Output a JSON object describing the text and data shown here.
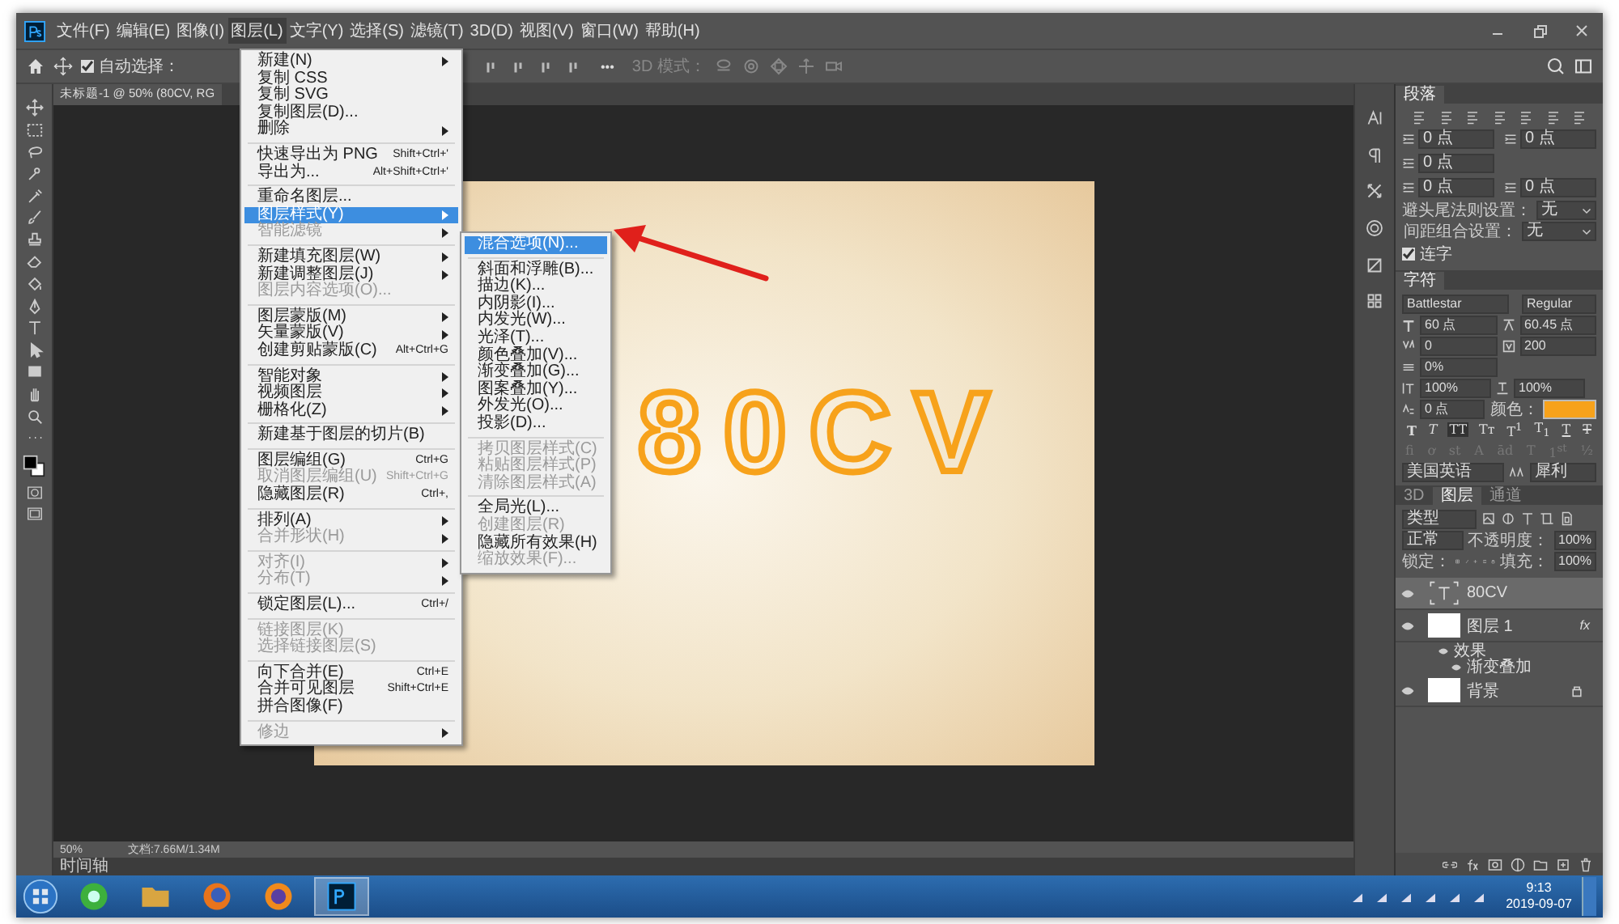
{
  "menubar": [
    {
      "label": "文件(F)",
      "selected": false
    },
    {
      "label": "编辑(E)",
      "selected": false
    },
    {
      "label": "图像(I)",
      "selected": false
    },
    {
      "label": "图层(L)",
      "selected": true
    },
    {
      "label": "文字(Y)",
      "selected": false
    },
    {
      "label": "选择(S)",
      "selected": false
    },
    {
      "label": "滤镜(T)",
      "selected": false
    },
    {
      "label": "3D(D)",
      "selected": false
    },
    {
      "label": "视图(V)",
      "selected": false
    },
    {
      "label": "窗口(W)",
      "selected": false
    },
    {
      "label": "帮助(H)",
      "selected": false
    }
  ],
  "options_bar": {
    "auto_select": {
      "label": "自动选择：",
      "checked": true
    },
    "more": "•••",
    "mode_3d": "3D 模式："
  },
  "document": {
    "tab": "未标题-1 @ 50% (80CV, RG",
    "canvas_text": "80CV"
  },
  "menu": {
    "groups": [
      [
        {
          "label": "新建(N)",
          "submenu": true,
          "disabled": false,
          "selected": false
        },
        {
          "label": "复制 CSS",
          "submenu": false,
          "disabled": false,
          "selected": false
        },
        {
          "label": "复制 SVG",
          "submenu": false,
          "disabled": false,
          "selected": false
        },
        {
          "label": "复制图层(D)...",
          "submenu": false,
          "disabled": false,
          "selected": false
        },
        {
          "label": "删除",
          "submenu": true,
          "disabled": false,
          "selected": false
        }
      ],
      [
        {
          "label": "快速导出为 PNG",
          "shortcut": "Shift+Ctrl+'",
          "submenu": false,
          "disabled": false,
          "selected": false
        },
        {
          "label": "导出为...",
          "shortcut": "Alt+Shift+Ctrl+'",
          "submenu": false,
          "disabled": false,
          "selected": false
        }
      ],
      [
        {
          "label": "重命名图层...",
          "submenu": false,
          "disabled": false,
          "selected": false
        },
        {
          "label": "图层样式(Y)",
          "submenu": true,
          "disabled": false,
          "selected": true
        },
        {
          "label": "智能滤镜",
          "submenu": true,
          "disabled": true,
          "selected": false
        }
      ],
      [
        {
          "label": "新建填充图层(W)",
          "submenu": true,
          "disabled": false,
          "selected": false
        },
        {
          "label": "新建调整图层(J)",
          "submenu": true,
          "disabled": false,
          "selected": false
        },
        {
          "label": "图层内容选项(O)...",
          "submenu": false,
          "disabled": true,
          "selected": false
        }
      ],
      [
        {
          "label": "图层蒙版(M)",
          "submenu": true,
          "disabled": false,
          "selected": false
        },
        {
          "label": "矢量蒙版(V)",
          "submenu": true,
          "disabled": false,
          "selected": false
        },
        {
          "label": "创建剪贴蒙版(C)",
          "shortcut": "Alt+Ctrl+G",
          "submenu": false,
          "disabled": false,
          "selected": false
        }
      ],
      [
        {
          "label": "智能对象",
          "submenu": true,
          "disabled": false,
          "selected": false
        },
        {
          "label": "视频图层",
          "submenu": true,
          "disabled": false,
          "selected": false
        },
        {
          "label": "栅格化(Z)",
          "submenu": true,
          "disabled": false,
          "selected": false
        }
      ],
      [
        {
          "label": "新建基于图层的切片(B)",
          "submenu": false,
          "disabled": false,
          "selected": false
        }
      ],
      [
        {
          "label": "图层编组(G)",
          "shortcut": "Ctrl+G",
          "submenu": false,
          "disabled": false,
          "selected": false
        },
        {
          "label": "取消图层编组(U)",
          "shortcut": "Shift+Ctrl+G",
          "submenu": false,
          "disabled": true,
          "selected": false
        },
        {
          "label": "隐藏图层(R)",
          "shortcut": "Ctrl+,",
          "submenu": false,
          "disabled": false,
          "selected": false
        }
      ],
      [
        {
          "label": "排列(A)",
          "submenu": true,
          "disabled": false,
          "selected": false
        },
        {
          "label": "合并形状(H)",
          "submenu": true,
          "disabled": true,
          "selected": false
        }
      ],
      [
        {
          "label": "对齐(I)",
          "submenu": true,
          "disabled": true,
          "selected": false
        },
        {
          "label": "分布(T)",
          "submenu": true,
          "disabled": true,
          "selected": false
        }
      ],
      [
        {
          "label": "锁定图层(L)...",
          "shortcut": "Ctrl+/",
          "submenu": false,
          "disabled": false,
          "selected": false
        }
      ],
      [
        {
          "label": "链接图层(K)",
          "submenu": false,
          "disabled": true,
          "selected": false
        },
        {
          "label": "选择链接图层(S)",
          "submenu": false,
          "disabled": true,
          "selected": false
        }
      ],
      [
        {
          "label": "向下合并(E)",
          "shortcut": "Ctrl+E",
          "submenu": false,
          "disabled": false,
          "selected": false
        },
        {
          "label": "合并可见图层",
          "shortcut": "Shift+Ctrl+E",
          "submenu": false,
          "disabled": false,
          "selected": false
        },
        {
          "label": "拼合图像(F)",
          "submenu": false,
          "disabled": false,
          "selected": false
        }
      ],
      [
        {
          "label": "修边",
          "submenu": true,
          "disabled": true,
          "selected": false
        }
      ]
    ]
  },
  "submenu": {
    "groups": [
      [
        {
          "label": "混合选项(N)...",
          "disabled": false,
          "selected": true
        }
      ],
      [
        {
          "label": "斜面和浮雕(B)...",
          "disabled": false,
          "selected": false
        },
        {
          "label": "描边(K)...",
          "disabled": false,
          "selected": false
        },
        {
          "label": "内阴影(I)...",
          "disabled": false,
          "selected": false
        },
        {
          "label": "内发光(W)...",
          "disabled": false,
          "selected": false
        },
        {
          "label": "光泽(T)...",
          "disabled": false,
          "selected": false
        },
        {
          "label": "颜色叠加(V)...",
          "disabled": false,
          "selected": false
        },
        {
          "label": "渐变叠加(G)...",
          "disabled": false,
          "selected": false
        },
        {
          "label": "图案叠加(Y)...",
          "disabled": false,
          "selected": false
        },
        {
          "label": "外发光(O)...",
          "disabled": false,
          "selected": false
        },
        {
          "label": "投影(D)...",
          "disabled": false,
          "selected": false
        }
      ],
      [
        {
          "label": "拷贝图层样式(C)",
          "disabled": true,
          "selected": false
        },
        {
          "label": "粘贴图层样式(P)",
          "disabled": true,
          "selected": false
        },
        {
          "label": "清除图层样式(A)",
          "disabled": true,
          "selected": false
        }
      ],
      [
        {
          "label": "全局光(L)...",
          "disabled": false,
          "selected": false
        },
        {
          "label": "创建图层(R)",
          "disabled": true,
          "selected": false
        },
        {
          "label": "隐藏所有效果(H)",
          "disabled": false,
          "selected": false
        },
        {
          "label": "缩放效果(F)...",
          "disabled": true,
          "selected": false
        }
      ]
    ]
  },
  "paragraph_panel": {
    "title": "段落",
    "indents": [
      "0 点",
      "0 点",
      "0 点",
      "0 点",
      "0 点"
    ],
    "settings": [
      {
        "label": "避头尾法则设置：",
        "value": "无"
      },
      {
        "label": "间距组合设置：",
        "value": "无"
      }
    ],
    "hyphenate": {
      "label": "连字",
      "checked": true
    }
  },
  "character_panel": {
    "title": "字符",
    "font": "Battlestar",
    "style": "Regular",
    "size": "60 点",
    "leading": "60.45 点",
    "kerning": "0",
    "tracking": "200",
    "tsume": "0%",
    "vertical_scale": "100%",
    "horizontal_scale": "100%",
    "baseline": "0 点",
    "color_label": "颜色：",
    "color": "#f7a21b",
    "type_styles": [
      {
        "label": "T",
        "kind": "bold",
        "selected": false
      },
      {
        "label": "T",
        "kind": "italic",
        "selected": false
      },
      {
        "label": "TT",
        "kind": "caps",
        "selected": true
      },
      {
        "label": "Tᴛ",
        "kind": "smallcaps",
        "selected": false
      },
      {
        "label": "T$^{1}$",
        "kind": "super",
        "selected": false
      },
      {
        "label": "T$_{1}$",
        "kind": "sub",
        "selected": false
      },
      {
        "label": "T",
        "kind": "underline",
        "selected": false
      },
      {
        "label": "T",
        "kind": "strike",
        "selected": false
      }
    ],
    "opentype": [
      "fi",
      "ơ",
      "st",
      "A",
      "ād",
      "T",
      "1$^{st}$",
      "½"
    ],
    "language": "美国英语",
    "antialias": "犀利"
  },
  "layers_panel": {
    "tabs": [
      {
        "label": "3D",
        "selected": false
      },
      {
        "label": "图层",
        "selected": true
      },
      {
        "label": "通道",
        "selected": false
      }
    ],
    "filter": "类型",
    "blend": "正常",
    "opacity_label": "不透明度：",
    "opacity": "100%",
    "lock_label": "锁定：",
    "fill_label": "填充：",
    "fill": "100%",
    "layers": [
      {
        "name": "80CV",
        "kind": "text",
        "selected": true,
        "visible": true,
        "locked": false
      },
      {
        "name": "图层 1",
        "kind": "pixel",
        "selected": false,
        "visible": true,
        "locked": false,
        "badge": "fx",
        "children": [
          {
            "name": "效果",
            "visible": true,
            "children": [
              {
                "name": "渐变叠加",
                "visible": true
              }
            ]
          }
        ]
      },
      {
        "name": "背景",
        "kind": "pixel",
        "selected": false,
        "visible": true,
        "locked": true
      }
    ]
  },
  "status_bar": {
    "zoom": "50%",
    "doc_size": "文档:7.66M/1.34M",
    "timeline": "时间轴"
  },
  "taskbar": {
    "time": "9:13",
    "date": "2019-09-07"
  }
}
